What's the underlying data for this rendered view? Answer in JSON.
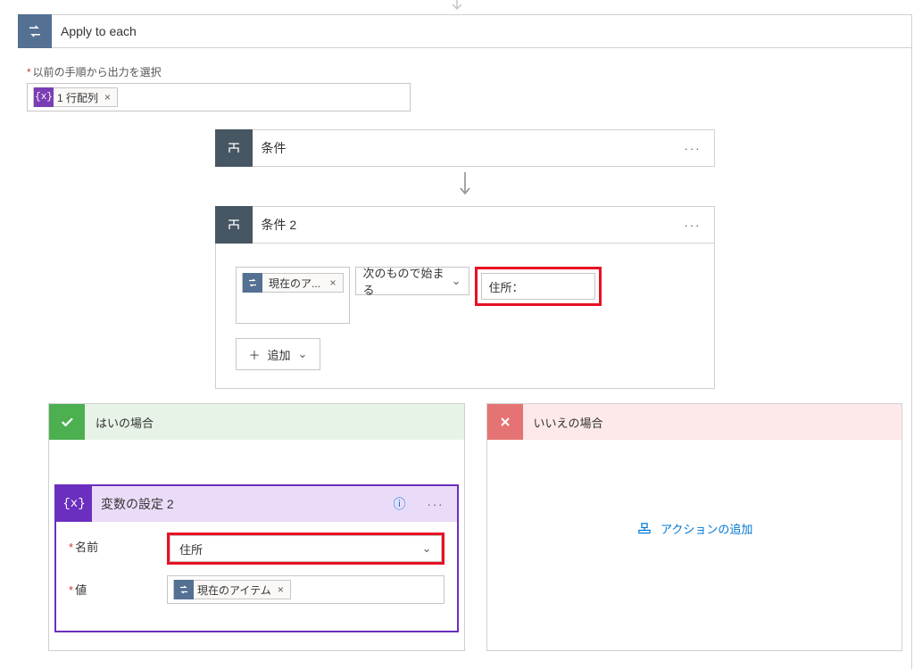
{
  "apply_to_each": {
    "title": "Apply to each",
    "input_label": "以前の手順から出力を選択",
    "token": {
      "label": "1 行配列"
    }
  },
  "condition1": {
    "title": "条件"
  },
  "condition2": {
    "title": "条件 2",
    "left_token": "現在のア...",
    "operator": "次のもので始まる",
    "right_value": "住所：",
    "add_label": "追加"
  },
  "branch": {
    "yes": "はいの場合",
    "no": "いいえの場合",
    "add_action": "アクションの追加"
  },
  "set_var": {
    "title": "変数の設定 2",
    "name_label": "名前",
    "value_label": "値",
    "name_value": "住所",
    "value_token": "現在のアイテム"
  }
}
